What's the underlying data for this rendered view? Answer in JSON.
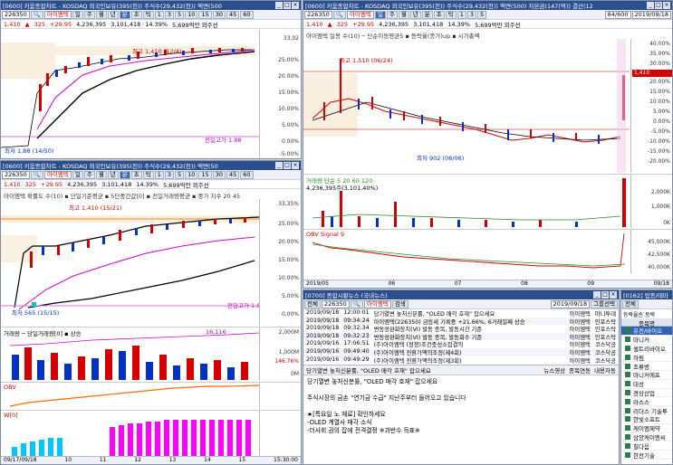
{
  "colors": {
    "up": "#d40000",
    "down": "#0032c8",
    "accent": "#2b4f8e"
  },
  "w1": {
    "title": "[0600] 키움종합차트 - KOSDAQ 외국인보유(395(천)) 주식수(29,432(천)) 액면(500",
    "code": "226350",
    "name": "아이엠텍",
    "periods": [
      "일",
      "주",
      "월",
      "년",
      "분",
      "초",
      "틱"
    ],
    "nums": [
      "1",
      "3",
      "5",
      "10",
      "15",
      "30",
      "45",
      "60"
    ],
    "price": "1,410",
    "arrow": "▲",
    "change": "325",
    "pct": "+29.95",
    "vol": "4,236,395",
    "amt": "3,101,418",
    "turn": "14.39%",
    "cap": "5,699억만 외주선",
    "maxlabel": "최고 1,410 (12/4)",
    "minlabel": "최저 1,88 (14/50)",
    "pctlabel": "전일고가 1.88",
    "axis": [
      "33.02",
      "25.00%",
      "20.00%",
      "15.00%",
      "10.00%",
      "5.00%",
      "0.00%",
      "-5.00%"
    ]
  },
  "w2": {
    "title": "[0600] 키움종합차트 - KOSDAQ 외국인보유(395(천)) 주식수(29,432(천)) 액면(500) 자본금(147(억)) 결산(12",
    "code": "226350",
    "name": "아이엠텍",
    "price": "1,410",
    "arrow": "▲",
    "change": "325",
    "pct": "+29.95",
    "vol": "4,236,395",
    "amt": "3,101,418",
    "turn": "14.39%",
    "cap": "5,699억만 외주선",
    "zoom": "84/600",
    "date": "2019/09/18",
    "indicator": "아이엠텍 일봉 수(10) ─ 단순이동평균5 ▪ 등락율(종가)up ▪ 시가총액",
    "maxlabel": "최고 1,510 (06/24)",
    "minlabel": "최저 902 (08/06)",
    "axis": [
      "40.00%",
      "35.00%",
      "30.00%",
      "25.00%",
      "20.00%",
      "15.00%",
      "10.00%",
      "5.00%",
      "0.00%",
      "-5.00%",
      "-10.00%",
      "-15.00%",
      "-20.00%"
    ],
    "pricetag": "1,410",
    "volLabel": "거래량 단순 5 20 60 120",
    "volValue": "4,236,395주(3,101.40%)",
    "volAxis": [
      "2,000K",
      "1,000K",
      "0K"
    ],
    "obvLabel": "OBV Signal 9",
    "obvAxis": [
      "45,000K",
      "42,500K",
      "40,000K"
    ],
    "months": [
      "2019/05",
      "06",
      "07",
      "08",
      "09",
      "09/18"
    ]
  },
  "w3": {
    "title": "[0600] 키움종합차트 - KOSDAQ 외국인보유(395(천)) 주식수(29,432(천)) 액면(50",
    "code": "226350",
    "name": "아이엠텍",
    "price": "1,410",
    "change": "325",
    "pct": "+29.95",
    "vol": "4,236,395",
    "amt": "3,101,418",
    "turn": "14.39%",
    "cap": "5,699억만 외주선",
    "indicator": "아이엠텍 확률도 수(10) ▪ 단일기준평균 ▪ 5단중간값[0] ▪ 전일거래량평균 ▪ 중가 지수 20 45",
    "axis": [
      "33.35%",
      "25.00%",
      "20.00%",
      "15.00%",
      "10.00%",
      "5.00%",
      "0.00%"
    ],
    "maxlabel": "최고 1,410 (15/21)",
    "minlabel": "최저 565 (15/15)",
    "prevlabel": "전일고가 1.88",
    "volLabel": "거래량 ─ 당일거래량[0] ▪ 상승",
    "volAxis": [
      "2,000M",
      "1,000M",
      "0M"
    ],
    "volTag": "16,116",
    "volPct": "146.76%",
    "obvLabel": "OBV",
    "wLabel": "W[0]",
    "dates": [
      "09/17/09/18",
      "10",
      "11",
      "12",
      "13",
      "14",
      "15",
      "15:30:00"
    ]
  },
  "w4": {
    "title": "[0700] 종합시황뉴스 (국내뉴스)",
    "search": "검색",
    "all": "전체",
    "code": "226350",
    "name": "아이엠텍",
    "date": "2019/09/18",
    "btn": "그룹선택",
    "rows": [
      {
        "date": "2019/09/18",
        "time": "12:00:01",
        "text": "당기열변 놓처신분률, \"OLED 매각 호재\" 잡으세요",
        "src": "아이엠텍",
        "cat": "마니투데"
      },
      {
        "date": "2019/09/18",
        "time": "09:34:24",
        "text": "아이엠텍(226350) 금등세 기록중 +21.66%, 6거래일째 상승",
        "src": "아이엠텍",
        "cat": "인포스탁"
      },
      {
        "date": "2019/09/18",
        "time": "09:32:34",
        "text": "변동성완화장치(VI) 발동 종목, 발동시간 기준",
        "src": "아이엠텍",
        "cat": "인포스탁"
      },
      {
        "date": "2019/09/18",
        "time": "09:32:23",
        "text": "변동성완화장치(VI) 발동 종목, 발동회수 기준",
        "src": "아이엠텍",
        "cat": "인포스탁"
      },
      {
        "date": "2019/09/16",
        "time": "17:06:51",
        "text": "(주)아이엠텍 (정정)조건충성소집결의",
        "src": "아이엠텍",
        "cat": "코스닥공"
      },
      {
        "date": "2019/09/16",
        "time": "09:49:40",
        "text": "(주)아이엠텍 전환가액의조정(제4회)",
        "src": "아이엠텍",
        "cat": "코스닥공"
      },
      {
        "date": "2019/09/16",
        "time": "09:49:29",
        "text": "(주)아이엠텍 전환가액의조정(제3회)",
        "src": "아이엠텍",
        "cat": "코스닥공"
      }
    ],
    "headline": "당기열변 놓처신분률, \"OLED 매각 호재\" 잡으세요",
    "link": "뉴스영상",
    "link2": "종목연동",
    "link3": "내용자동",
    "body": [
      "당기열변 놓처신분률, \"OLED 매각 호재\" 잡으세요",
      "",
      "주식시장의 금손 \"연기금 수급\" 지난주부터 들어오고 있습니다",
      "",
      "★[특요일 노 재료] 확인하세요",
      "-OLED 계열사 매각 소식",
      "-더사회 권의 잡에 전격결정 ※과반수 득표※"
    ]
  },
  "w5": {
    "title": "[0162] 업종/테마",
    "all": "전체",
    "radio": "등락율순",
    "radio2": "등락",
    "header": "종목명",
    "items": [
      "유전/바이오",
      "마니커",
      "셀트리바이오",
      "하림",
      "조류병",
      "마니커에프",
      "대성",
      "경상산업",
      "라스스",
      "리더스 기술투",
      "한빛소프트",
      "케이엠제약",
      "삼양케이엔씨",
      "칠다음",
      "한전기술"
    ],
    "highlight": 0
  }
}
